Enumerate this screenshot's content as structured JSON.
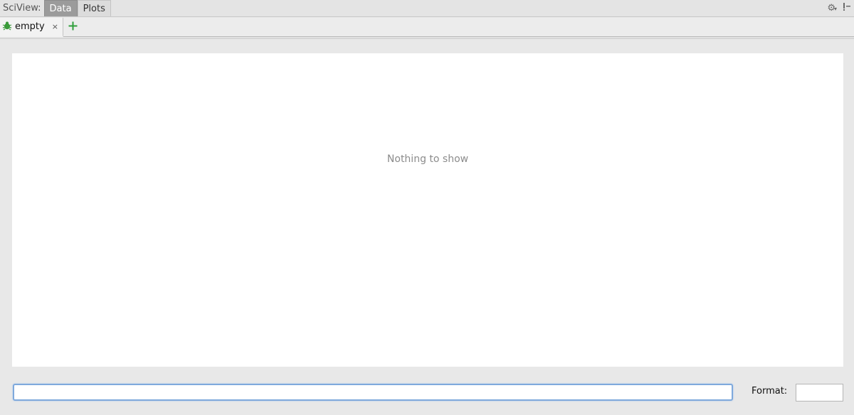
{
  "toolwindow": {
    "title": "SciView:",
    "view_tabs": [
      {
        "label": "Data",
        "active": true
      },
      {
        "label": "Plots",
        "active": false
      }
    ],
    "right_icons": [
      "gear-icon",
      "hide-icon"
    ]
  },
  "tabs": [
    {
      "label": "empty",
      "icon": "python-bug-icon",
      "close": "×"
    }
  ],
  "add_tab_icon": "plus-icon",
  "main": {
    "empty_message": "Nothing to show"
  },
  "bottom": {
    "filter_value": "",
    "format_label": "Format:",
    "format_value": ""
  },
  "colors": {
    "active_tab_bg": "#9b9b9b",
    "add_icon": "#2e9e3a",
    "focus_border": "#7fa9dc"
  }
}
